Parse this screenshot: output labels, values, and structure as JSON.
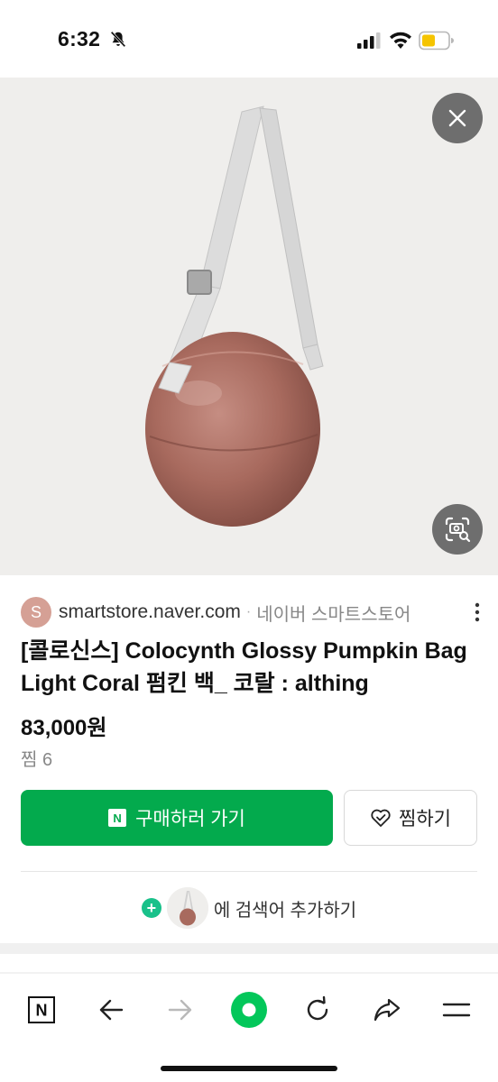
{
  "status_bar": {
    "time": "6:32"
  },
  "product": {
    "source_avatar": "S",
    "source_domain": "smartstore.naver.com",
    "source_separator": "·",
    "source_name": "네이버 스마트스토어",
    "title": "[콜로신스] Colocynth Glossy Pumpkin Bag Light Coral 펌킨 백_ 코랄 : althing",
    "price": "83,000원",
    "likes": "찜 6"
  },
  "actions": {
    "buy_badge": "N",
    "buy_label": "구매하러 가기",
    "wish_label": "찜하기",
    "add_search_label": "에 검색어 추가하기"
  },
  "toolbar": {
    "home_label": "N",
    "items": [
      "naver-home",
      "back",
      "forward",
      "green-dot",
      "reload",
      "share",
      "menu"
    ]
  },
  "colors": {
    "accent_green": "#03aa4d",
    "plus_teal": "#19c18a",
    "avatar_pink": "#d5a095",
    "bag_copper": "#a86a5e"
  }
}
